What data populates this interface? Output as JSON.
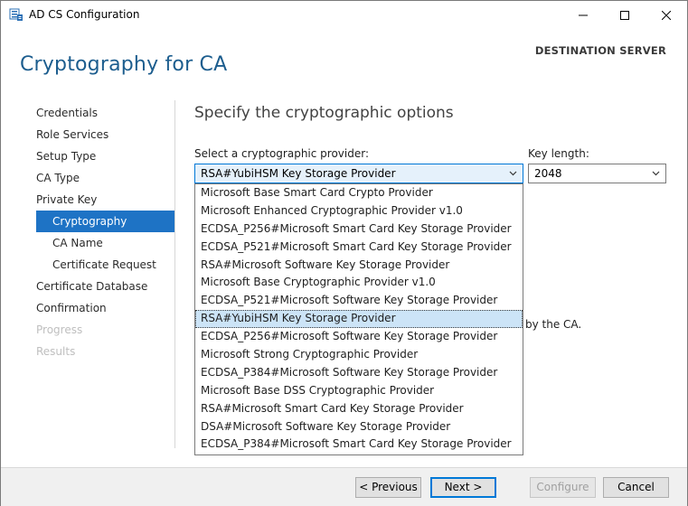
{
  "window": {
    "title": "AD CS Configuration"
  },
  "header": {
    "page_title": "Cryptography for CA",
    "destination_server": "DESTINATION SERVER"
  },
  "nav": {
    "items": [
      {
        "label": "Credentials",
        "state": "normal",
        "level": 0
      },
      {
        "label": "Role Services",
        "state": "normal",
        "level": 0
      },
      {
        "label": "Setup Type",
        "state": "normal",
        "level": 0
      },
      {
        "label": "CA Type",
        "state": "normal",
        "level": 0
      },
      {
        "label": "Private Key",
        "state": "normal",
        "level": 0
      },
      {
        "label": "Cryptography",
        "state": "active",
        "level": 1
      },
      {
        "label": "CA Name",
        "state": "normal",
        "level": 1
      },
      {
        "label": "Certificate Request",
        "state": "normal",
        "level": 1
      },
      {
        "label": "Certificate Database",
        "state": "normal",
        "level": 0
      },
      {
        "label": "Confirmation",
        "state": "normal",
        "level": 0
      },
      {
        "label": "Progress",
        "state": "disabled",
        "level": 0
      },
      {
        "label": "Results",
        "state": "disabled",
        "level": 0
      }
    ]
  },
  "content": {
    "heading": "Specify the cryptographic options",
    "provider_label": "Select a cryptographic provider:",
    "provider_value": "RSA#YubiHSM Key Storage Provider",
    "key_length_label": "Key length:",
    "key_length_value": "2048",
    "peek_text": "by the CA.",
    "provider_options": [
      "Microsoft Base Smart Card Crypto Provider",
      "Microsoft Enhanced Cryptographic Provider v1.0",
      "ECDSA_P256#Microsoft Smart Card Key Storage Provider",
      "ECDSA_P521#Microsoft Smart Card Key Storage Provider",
      "RSA#Microsoft Software Key Storage Provider",
      "Microsoft Base Cryptographic Provider v1.0",
      "ECDSA_P521#Microsoft Software Key Storage Provider",
      "RSA#YubiHSM Key Storage Provider",
      "ECDSA_P256#Microsoft Software Key Storage Provider",
      "Microsoft Strong Cryptographic Provider",
      "ECDSA_P384#Microsoft Software Key Storage Provider",
      "Microsoft Base DSS Cryptographic Provider",
      "RSA#Microsoft Smart Card Key Storage Provider",
      "DSA#Microsoft Software Key Storage Provider",
      "ECDSA_P384#Microsoft Smart Card Key Storage Provider"
    ],
    "selected_option": "RSA#YubiHSM Key Storage Provider"
  },
  "footer": {
    "previous": "< Previous",
    "next": "Next >",
    "configure": "Configure",
    "cancel": "Cancel"
  },
  "colors": {
    "heading": "#1c5d8e",
    "nav_active": "#1e73c5",
    "selection": "#cce4f7",
    "focus": "#0078d7"
  }
}
